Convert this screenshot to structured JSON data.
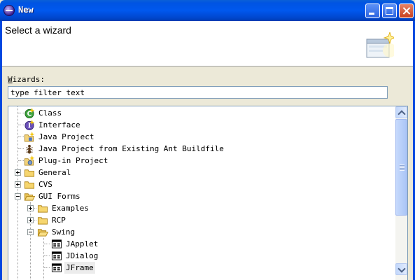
{
  "window": {
    "title": "New"
  },
  "header": {
    "title": "Select a wizard"
  },
  "wizards": {
    "label_mnemonic": "W",
    "label_rest": "izards:",
    "filter_value": "type filter text"
  },
  "tree": {
    "items": [
      {
        "label": "Class",
        "icon": "class-icon"
      },
      {
        "label": "Interface",
        "icon": "interface-icon"
      },
      {
        "label": "Java Project",
        "icon": "java-project-icon"
      },
      {
        "label": "Java Project from Existing Ant Buildfile",
        "icon": "ant-icon"
      },
      {
        "label": "Plug-in Project",
        "icon": "plugin-project-icon"
      },
      {
        "label": "General",
        "icon": "folder-icon"
      },
      {
        "label": "CVS",
        "icon": "folder-icon"
      },
      {
        "label": "GUI Forms",
        "icon": "folder-open-icon"
      },
      {
        "label": "Examples",
        "icon": "folder-icon"
      },
      {
        "label": "RCP",
        "icon": "folder-icon"
      },
      {
        "label": "Swing",
        "icon": "folder-open-icon"
      },
      {
        "label": "JApplet",
        "icon": "form-icon"
      },
      {
        "label": "JDialog",
        "icon": "form-icon"
      },
      {
        "label": "JFrame",
        "icon": "form-icon"
      }
    ]
  },
  "colors": {
    "titlebar": "#0054e3",
    "frame": "#0048e0",
    "selection": "#ececec"
  }
}
